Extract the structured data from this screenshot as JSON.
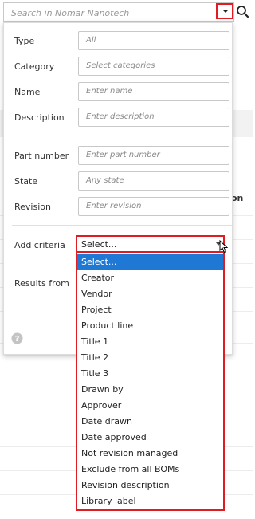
{
  "search": {
    "placeholder": "Search in Nomar Nanotech"
  },
  "background": {
    "column_header_fragment": "on"
  },
  "filters": {
    "type": {
      "label": "Type",
      "value": "All"
    },
    "category": {
      "label": "Category",
      "placeholder": "Select categories"
    },
    "name": {
      "label": "Name",
      "placeholder": "Enter name"
    },
    "description": {
      "label": "Description",
      "placeholder": "Enter description"
    },
    "part_number": {
      "label": "Part number",
      "placeholder": "Enter part number"
    },
    "state": {
      "label": "State",
      "value": "Any state"
    },
    "revision": {
      "label": "Revision",
      "placeholder": "Enter revision"
    },
    "add_criteria": {
      "label": "Add criteria",
      "selected": "Select..."
    },
    "results_from": {
      "label": "Results from"
    }
  },
  "criteria_options": [
    "Select...",
    "Creator",
    "Vendor",
    "Project",
    "Product line",
    "Title 1",
    "Title 2",
    "Title 3",
    "Drawn by",
    "Approver",
    "Date drawn",
    "Date approved",
    "Not revision managed",
    "Exclude from all BOMs",
    "Revision description",
    "Library label"
  ],
  "colors": {
    "highlight_red": "#e11b22",
    "selected_blue": "#1e78d4"
  },
  "icons": {
    "dropdown": "chevron-down-icon",
    "search": "search-icon",
    "help": "question-circle-icon",
    "cursor": "mouse-pointer-icon"
  }
}
